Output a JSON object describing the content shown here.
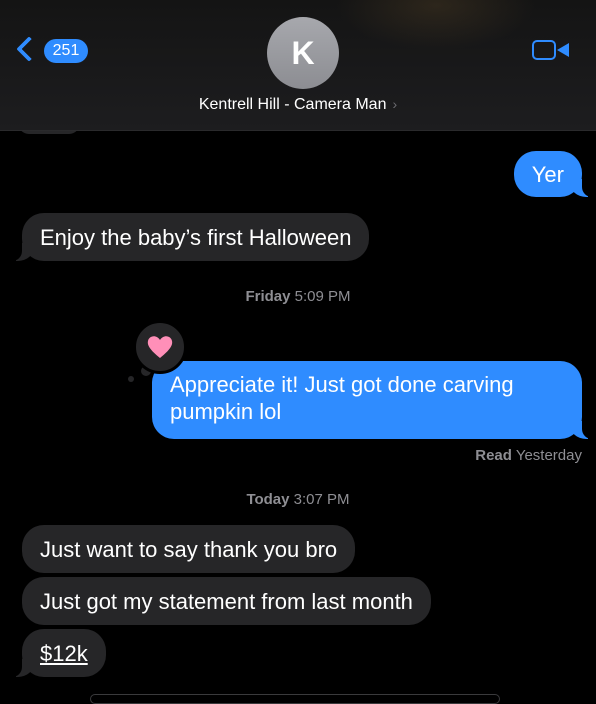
{
  "header": {
    "back_count": "251",
    "avatar_initial": "K",
    "contact_name": "Kentrell Hill - Camera Man",
    "contact_chevron": "›",
    "video_icon": "video-camera-icon"
  },
  "messages": [
    {
      "direction": "out",
      "text": "Yer"
    },
    {
      "direction": "in",
      "text": "Enjoy the baby’s first Halloween"
    },
    {
      "direction": "out",
      "text": "Appreciate it! Just got done carving pumpkin lol",
      "reaction": "heart"
    },
    {
      "direction": "in",
      "text": "Just want to say thank you bro"
    },
    {
      "direction": "in",
      "text": "Just got my statement from last month"
    },
    {
      "direction": "in",
      "text": "$12k",
      "link": true
    }
  ],
  "timestamps": [
    {
      "day": "Friday",
      "time": "5:09 PM"
    },
    {
      "day": "Today",
      "time": "3:07 PM"
    }
  ],
  "read_receipt": {
    "label": "Read",
    "when": "Yesterday"
  },
  "colors": {
    "accent": "#2f8cff",
    "incoming_bubble": "#262628",
    "background": "#000000",
    "reaction_heart": "#ff8fb8"
  }
}
